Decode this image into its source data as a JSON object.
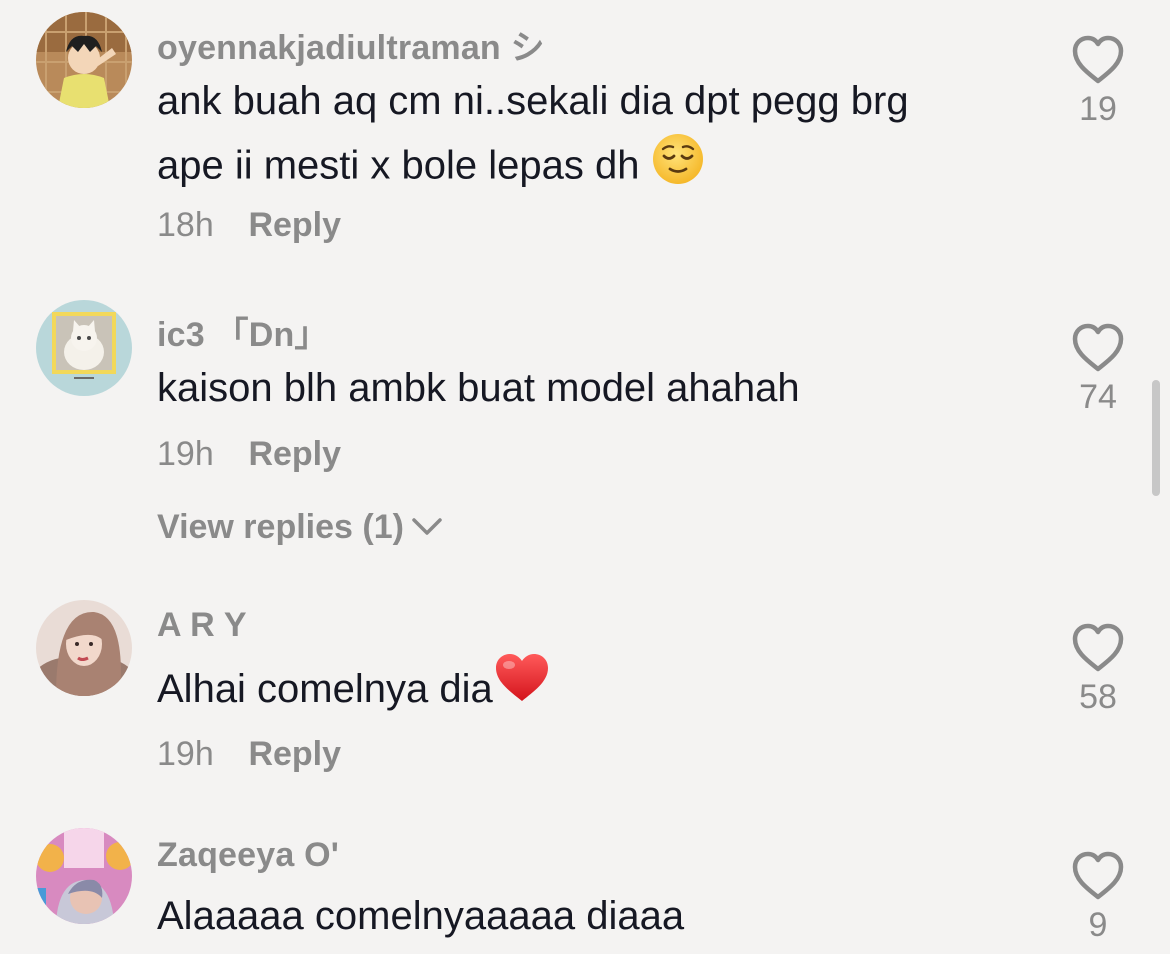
{
  "comments": [
    {
      "username": "oyennakjadiultraman シ",
      "text_line1": "ank buah aq cm ni..sekali dia dpt pegg brg",
      "text_line2": "ape ii mesti x bole lepas dh ",
      "emoji": "relieved-face",
      "time": "18h",
      "reply_label": "Reply",
      "likes": "19"
    },
    {
      "username": "ic3 「Dn」",
      "text": "kaison blh ambk buat model ahahah",
      "time": "19h",
      "reply_label": "Reply",
      "view_replies": "View replies (1)",
      "likes": "74"
    },
    {
      "username": "A R Y",
      "text": "Alhai comelnya dia",
      "emoji": "red-heart",
      "time": "19h",
      "reply_label": "Reply",
      "likes": "58"
    },
    {
      "username": "Zaqeeya O'",
      "text": "Alaaaaa comelnyaaaaa diaaa",
      "likes": "9"
    }
  ],
  "colors": {
    "background": "#f4f3f2",
    "text": "#161823",
    "muted": "#8a8a8a",
    "heart_outline": "#8a8a8a"
  },
  "icons": [
    "heart-outline-icon",
    "chevron-down-icon"
  ]
}
